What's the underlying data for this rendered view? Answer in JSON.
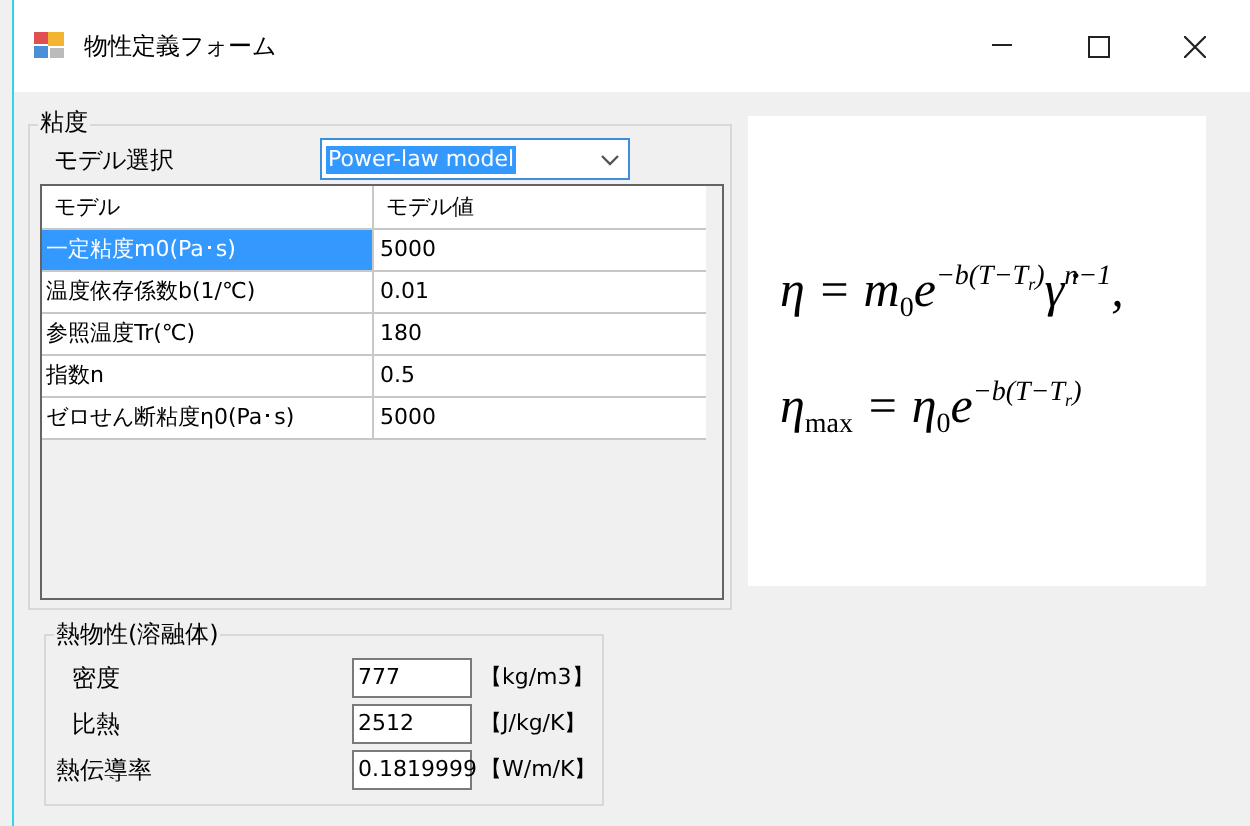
{
  "window": {
    "title": "物性定義フォーム"
  },
  "viscosity": {
    "group_label": "粘度",
    "model_label": "モデル選択",
    "model_select": {
      "value": "Power-law model",
      "focused": true
    },
    "table": {
      "columns": [
        "モデル",
        "モデル値"
      ],
      "rows": [
        {
          "name": "一定粘度m0(Pa･s)",
          "value": "5000",
          "selected": true
        },
        {
          "name": "温度依存係数b(1/℃)",
          "value": "0.01",
          "selected": false
        },
        {
          "name": "参照温度Tr(℃)",
          "value": "180",
          "selected": false
        },
        {
          "name": "指数n",
          "value": "0.5",
          "selected": false
        },
        {
          "name": "ゼロせん断粘度η0(Pa･s)",
          "value": "5000",
          "selected": false
        }
      ]
    }
  },
  "formula": [
    [
      {
        "kind": "base",
        "text": "η = m"
      },
      {
        "kind": "sub",
        "text": "0"
      },
      {
        "kind": "base",
        "text": "e"
      },
      {
        "kind": "sup",
        "text": "−b(T−T"
      },
      {
        "kind": "supsub",
        "text": "r"
      },
      {
        "kind": "sup",
        "text": ")"
      },
      {
        "kind": "base",
        "text": "γ̇"
      },
      {
        "kind": "sup",
        "text": "n−1"
      },
      {
        "kind": "base",
        "text": ","
      }
    ],
    [
      {
        "kind": "base",
        "text": "η"
      },
      {
        "kind": "sub",
        "text": "max"
      },
      {
        "kind": "base",
        "text": " = η"
      },
      {
        "kind": "sub",
        "text": "0"
      },
      {
        "kind": "base",
        "text": "e"
      },
      {
        "kind": "sup",
        "text": "−b(T−T"
      },
      {
        "kind": "supsub",
        "text": "r"
      },
      {
        "kind": "sup",
        "text": ")"
      }
    ]
  ],
  "thermal": {
    "group_label": "熱物性(溶融体)",
    "fields": [
      {
        "label": "密度",
        "value": "777",
        "unit": "【kg/m3】",
        "indent": true
      },
      {
        "label": "比熱",
        "value": "2512",
        "unit": "【J/kg/K】",
        "indent": true
      },
      {
        "label": "熱伝導率",
        "value": "0.1819999",
        "unit": "【W/m/K】",
        "indent": false
      }
    ]
  }
}
